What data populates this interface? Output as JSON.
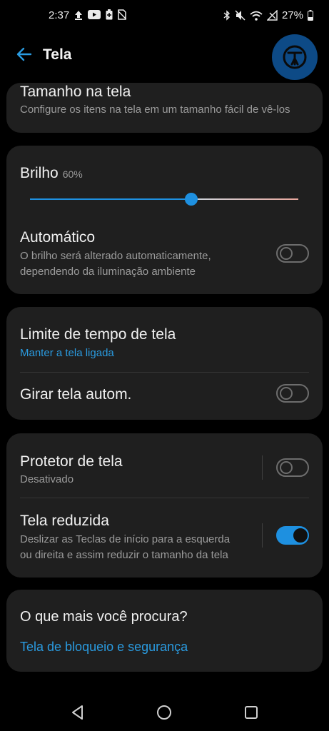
{
  "status_bar": {
    "time": "2:37",
    "battery_text": "27%",
    "left_icons": [
      "upload-icon",
      "youtube-icon",
      "battery-saver-icon",
      "no-sim-icon"
    ],
    "right_icons": [
      "bluetooth-icon",
      "mute-icon",
      "wifi-icon",
      "no-signal-icon",
      "battery-icon"
    ]
  },
  "header": {
    "title": "Tela"
  },
  "cards": {
    "screen_size": {
      "title": "Tamanho na tela",
      "subtitle": "Configure os itens na tela em um tamanho fácil de vê-los"
    },
    "brightness": {
      "label": "Brilho",
      "value_text": "60%",
      "value": 0.6,
      "auto_title": "Automático",
      "auto_subtitle_1": "O brilho será alterado automaticamente,",
      "auto_subtitle_2": "dependendo da iluminação ambiente",
      "auto_on": false
    },
    "timeout": {
      "title": "Limite de tempo de tela",
      "value": "Manter a tela ligada",
      "rotate_title": "Girar tela autom.",
      "rotate_on": false
    },
    "saver": {
      "title": "Protetor de tela",
      "subtitle": "Desativado",
      "on": false,
      "reduced_title": "Tela reduzida",
      "reduced_subtitle_1": "Deslizar as Teclas de início para a esquerda",
      "reduced_subtitle_2": "ou direita e assim reduzir o tamanho da tela",
      "reduced_on": true
    },
    "more": {
      "title": "O que mais você procura?",
      "link": "Tela de bloqueio e segurança"
    }
  },
  "colors": {
    "accent": "#1e90e0",
    "link": "#2a9be0",
    "card": "#1f1f1f",
    "background": "#000000"
  }
}
